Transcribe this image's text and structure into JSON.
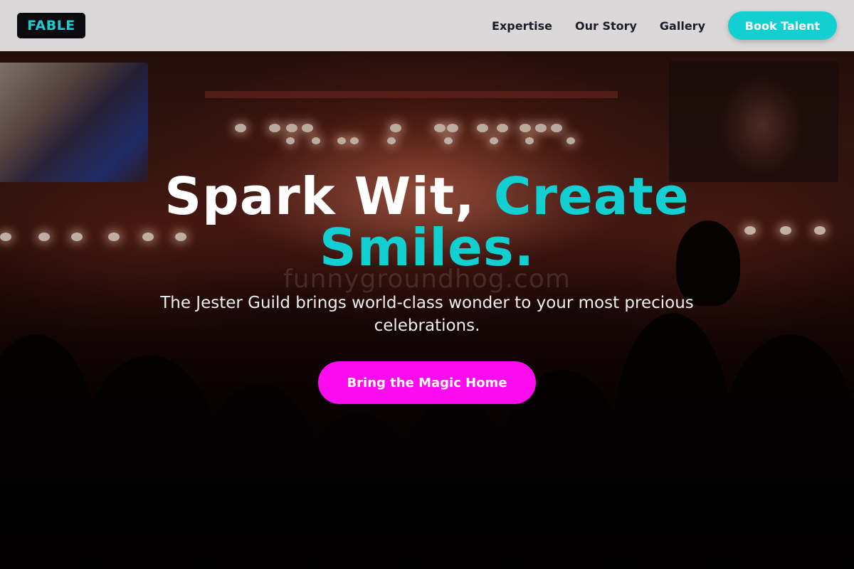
{
  "header": {
    "logo_text": "FABLE",
    "nav": [
      {
        "label": "Expertise"
      },
      {
        "label": "Our Story"
      },
      {
        "label": "Gallery"
      }
    ],
    "cta_label": "Book Talent"
  },
  "hero": {
    "headline_part1": "Spark Wit,",
    "headline_part2": "Create Smiles.",
    "subtext": "The Jester Guild brings world-class wonder to your most precious celebrations.",
    "cta_label": "Bring the Magic Home",
    "watermark": "funnygroundhog.com"
  },
  "colors": {
    "accent_cyan": "#12cfd2",
    "cta_magenta": "#ff0bf0",
    "logo_bg": "#0b0b0f",
    "header_bg": "#e8e8e8"
  }
}
